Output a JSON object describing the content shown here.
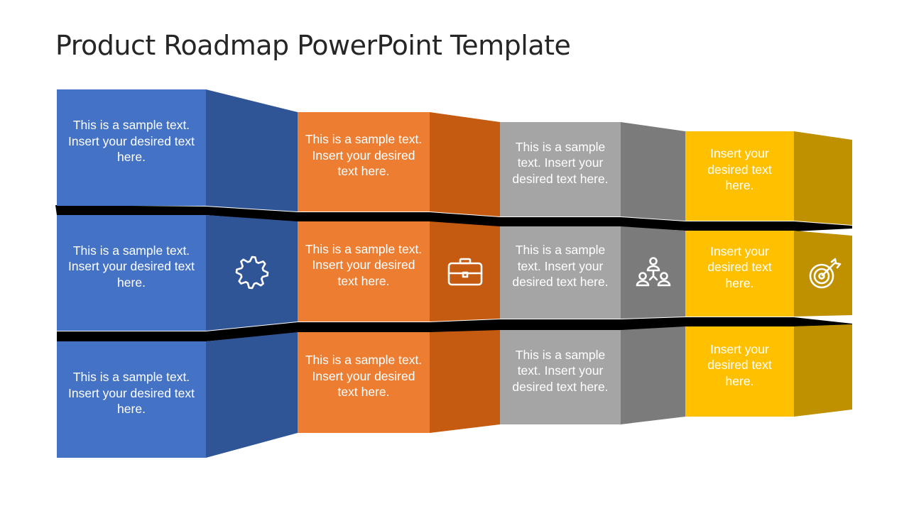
{
  "title": "Product Roadmap PowerPoint Template",
  "colors": {
    "blue_front": "#4472C4",
    "blue_side": "#2F5597",
    "orange_front": "#ED7D31",
    "orange_side": "#C55A11",
    "gray_front": "#A5A5A5",
    "gray_side": "#7B7B7B",
    "yellow_front": "#FFC000",
    "yellow_side": "#BF9000",
    "band": "#000000",
    "text": "#FFFFFF"
  },
  "columns": [
    {
      "name": "blue",
      "icon": "gear-icon",
      "rows": [
        {
          "text": "This is a sample text. Insert your desired text here."
        },
        {
          "text": "This is a sample text. Insert your desired text here."
        },
        {
          "text": "This is a sample text. Insert your desired text here."
        }
      ]
    },
    {
      "name": "orange",
      "icon": "briefcase-icon",
      "rows": [
        {
          "text": "This is a sample text. Insert your desired text here."
        },
        {
          "text": "This is a sample text. Insert your desired text here."
        },
        {
          "text": "This is a sample text. Insert your desired text here."
        }
      ]
    },
    {
      "name": "gray",
      "icon": "team-hierarchy-icon",
      "rows": [
        {
          "text": "This is a sample text. Insert your desired text here."
        },
        {
          "text": "This is a sample text. Insert your desired text here."
        },
        {
          "text": "This is a sample text. Insert your desired text here."
        }
      ]
    },
    {
      "name": "yellow",
      "icon": "target-icon",
      "rows": [
        {
          "text": "Insert your desired text here."
        },
        {
          "text": "Insert your desired text here."
        },
        {
          "text": "Insert your desired text here."
        }
      ]
    }
  ]
}
